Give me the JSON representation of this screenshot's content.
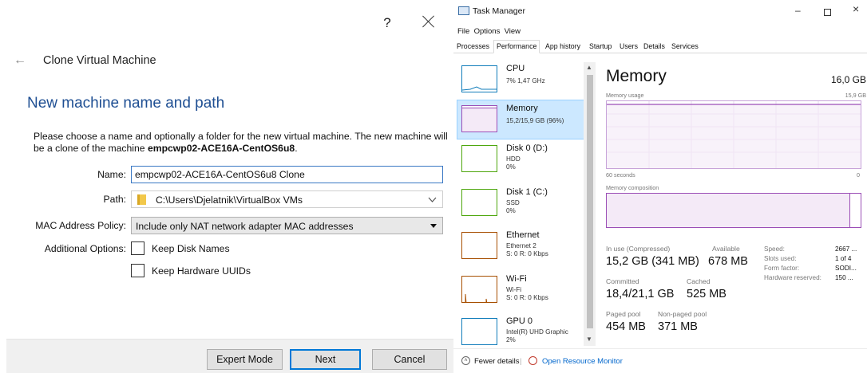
{
  "vbox": {
    "help_icon": "?",
    "title": "Clone Virtual Machine",
    "heading": "New machine name and path",
    "desc_prefix": "Please choose a name and optionally a folder for the new virtual machine. The new machine will be a clone of the machine ",
    "desc_machine": "empcwp02-ACE16A-CentOS6u8",
    "desc_suffix": ".",
    "name_label": "Name:",
    "name_value": "empcwp02-ACE16A-CentOS6u8 Clone",
    "path_label": "Path:",
    "path_value": "C:\\Users\\Djelatnik\\VirtualBox VMs",
    "mac_label": "MAC Address Policy:",
    "mac_value": "Include only NAT network adapter MAC addresses",
    "options_label": "Additional Options:",
    "keep_disk_names": "Keep Disk Names",
    "keep_hw_uuids": "Keep Hardware UUIDs",
    "btn_expert": "Expert Mode",
    "btn_next": "Next",
    "btn_cancel": "Cancel"
  },
  "tm": {
    "title": "Task Manager",
    "menu": "File  Options  View",
    "tabs": [
      "Processes",
      "Performance",
      "App history",
      "Startup",
      "Users",
      "Details",
      "Services"
    ],
    "sidebar": [
      {
        "name": "CPU",
        "sub1": "7% 1,47 GHz",
        "sub2": "",
        "sub3": ""
      },
      {
        "name": "Memory",
        "sub1": "15,2/15,9 GB (96%)",
        "sub2": "",
        "sub3": ""
      },
      {
        "name": "Disk 0 (D:)",
        "sub1": "HDD",
        "sub2": "0%",
        "sub3": ""
      },
      {
        "name": "Disk 1 (C:)",
        "sub1": "SSD",
        "sub2": "0%",
        "sub3": ""
      },
      {
        "name": "Ethernet",
        "sub1": "Ethernet 2",
        "sub2": "S: 0 R: 0 Kbps",
        "sub3": ""
      },
      {
        "name": "Wi-Fi",
        "sub1": "Wi-Fi",
        "sub2": "S: 0 R: 0 Kbps",
        "sub3": ""
      },
      {
        "name": "GPU 0",
        "sub1": "Intel(R) UHD Graphic",
        "sub2": "2%",
        "sub3": ""
      }
    ],
    "mem_title": "Memory",
    "mem_total": "16,0 GB",
    "usage_label": "Memory usage",
    "usage_max": "15,9 GB",
    "seconds_label": "60 seconds",
    "zero_label": "0",
    "composition_label": "Memory composition",
    "composition_used_fraction": 0.96,
    "inuse_label": "In use (Compressed)",
    "inuse_value": "15,2 GB (341 MB)",
    "available_label": "Available",
    "available_value": "678 MB",
    "committed_label": "Committed",
    "committed_value": "18,4/21,1 GB",
    "cached_label": "Cached",
    "cached_value": "525 MB",
    "paged_label": "Paged pool",
    "paged_value": "454 MB",
    "nonpaged_label": "Non-paged pool",
    "nonpaged_value": "371 MB",
    "speed_label": "Speed:",
    "speed_value": "2667 ...",
    "slots_label": "Slots used:",
    "slots_value": "1 of 4",
    "form_label": "Form factor:",
    "form_value": "SODI...",
    "hwres_label": "Hardware reserved:",
    "hwres_value": "150 ...",
    "fewer_details": "Fewer details",
    "open_monitor": "Open Resource Monitor",
    "colors": {
      "memory": "#9b4eb6",
      "cpu": "#117dbb",
      "disk": "#4da60c",
      "net": "#a74f01",
      "accent": "#0078d7"
    }
  }
}
